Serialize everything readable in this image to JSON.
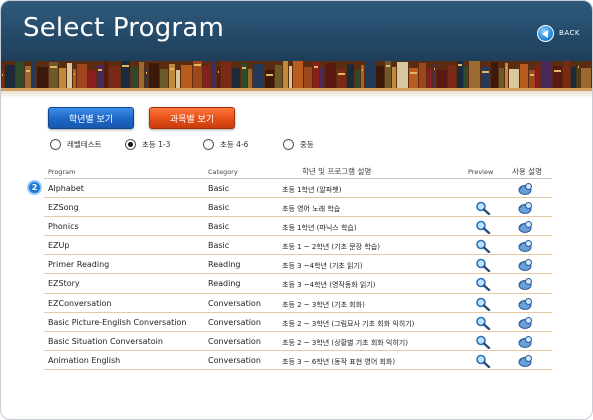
{
  "header": {
    "title": "Select Program",
    "back_label": "BACK"
  },
  "view_buttons": {
    "by_grade": "학년별 보기",
    "by_subject": "과목별 보기"
  },
  "filters": [
    {
      "label": "레벨테스트",
      "checked": false
    },
    {
      "label": "초등 1-3",
      "checked": true
    },
    {
      "label": "초등 4-6",
      "checked": false
    },
    {
      "label": "중등",
      "checked": false
    }
  ],
  "table": {
    "columns": {
      "program": "Program",
      "category": "Category",
      "description": "학년 및 프로그램 설명",
      "preview": "Preview",
      "guide": "사용 설명"
    },
    "current_row_badge": "2",
    "rows": [
      {
        "program": "Alphabet",
        "category": "Basic",
        "description": "초등 1학년 (알파벳)",
        "preview": false
      },
      {
        "program": "EZSong",
        "category": "Basic",
        "description": "초등 영어 노래 학습",
        "preview": true
      },
      {
        "program": "Phonics",
        "category": "Basic",
        "description": "초등 1학년 (파닉스 학습)",
        "preview": true
      },
      {
        "program": "EZUp",
        "category": "Basic",
        "description": "초등 1 ~ 2학년 (기초 문장 학습)",
        "preview": true
      },
      {
        "program": "Primer Reading",
        "category": "Reading",
        "description": "초등 3 ~4학년 (기초 읽기)",
        "preview": true
      },
      {
        "program": "EZStory",
        "category": "Reading",
        "description": "초등 3 ~4학년 (영작동화 읽기)",
        "preview": true
      },
      {
        "program": "EZConversation",
        "category": "Conversation",
        "description": "초등 2 ~ 3학년 (기초 회화)",
        "preview": true
      },
      {
        "program": "Basic Picture-English Conversation",
        "category": "Conversation",
        "description": "초등 2 ~ 3학년 (그림묘사 기초 회화 익히기)",
        "preview": true
      },
      {
        "program": "Basic Situation Conversatoin",
        "category": "Conversation",
        "description": "초등 2 ~ 3학년 (상황별 기초 회화 익히기)",
        "preview": true
      },
      {
        "program": "Animation English",
        "category": "Conversation",
        "description": "초등 3 ~ 6학년 (동작 표현 영어 회화)",
        "preview": true
      }
    ]
  },
  "icons": {
    "preview": "magnifier-icon",
    "guide": "guide-icon",
    "back": "back-arrow-icon"
  },
  "colors": {
    "header_blue": "#244a69",
    "grade_button": "#1f69c8",
    "subject_button": "#e8511a",
    "row_divider": "#e8c7a6"
  }
}
